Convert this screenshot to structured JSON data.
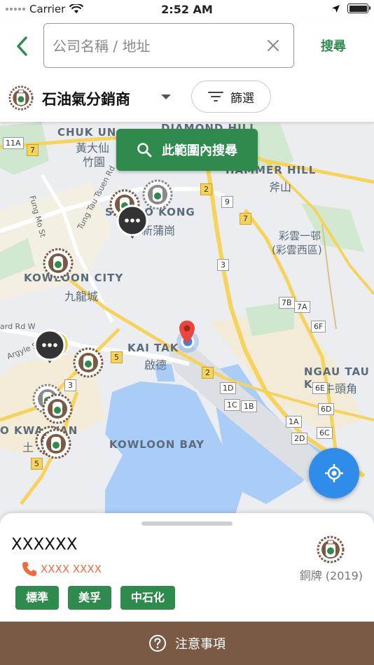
{
  "status_bar": {
    "carrier": "Carrier",
    "time": "2:52 AM"
  },
  "header": {
    "search_placeholder": "公司名稱 / 地址",
    "search_button": "搜尋",
    "category": "石油氣分銷商",
    "filter_label": "篩選"
  },
  "map": {
    "search_area_button": "此範圍內搜尋",
    "labels": {
      "chuk_un": "CHUK UN",
      "diamond_hill": "DIAMOND HILL",
      "wong_tai_sin": "黃大仙",
      "chuk_yuen": "竹園",
      "hammer_hill": "HAMMER HILL",
      "fu_shan": "斧山",
      "san_po_kong": "SAN PO KONG",
      "san_po_kong_zh": "新蒲崗",
      "choi_wan_1": "彩雲一邨",
      "choi_wan_2": "(彩雲西區)",
      "kowloon_city": "KOWLOON CITY",
      "kowloon_city_zh": "九龍城",
      "kai_tak": "KAI TAK",
      "kai_tak_zh": "啟德",
      "ngau_tau_kok": "NGAU TAU K",
      "ngau_tau_kok_zh": "牛頭角",
      "to_kwa_wan": "O KWA WAN",
      "to_kwa_wan_zh": "土",
      "kowloon_bay": "KOWLOON BAY",
      "fung_mo_st": "Fung Mo St",
      "tung_tau_tsuen_rd": "Tung Tau Tsuen Rd",
      "ward_rd": "ard Rd W",
      "argyle_st": "Argyle St",
      "route_11a": "11A",
      "route_7a": "7",
      "route_2": "2",
      "route_9": "9",
      "route_7b": "7",
      "route_3a": "3",
      "route_7b_2": "7B",
      "route_7a_2": "7A",
      "route_6f": "6F",
      "route_5a": "5",
      "route_2b": "2",
      "route_1d": "1D",
      "route_1c": "1C",
      "route_1b": "1B",
      "route_6e": "6E",
      "route_6d": "6D",
      "route_1a": "1A",
      "route_6c": "6C",
      "route_2d": "2D",
      "route_3b": "3",
      "route_5b": "5"
    },
    "cluster_glyph": "•••"
  },
  "sheet": {
    "company_name": "XXXXXX",
    "phone": "XXXX XXXX",
    "award": "銅牌 (2019)",
    "tags": [
      "標準",
      "美孚",
      "中石化"
    ]
  },
  "footer": {
    "notice": "注意事項"
  },
  "colors": {
    "accent_green": "#2e8a4d",
    "brown": "#7b5a45",
    "phone_orange": "#f06b3c",
    "locate_blue": "#2f8ce8",
    "road_yellow": "#f6d35a"
  }
}
